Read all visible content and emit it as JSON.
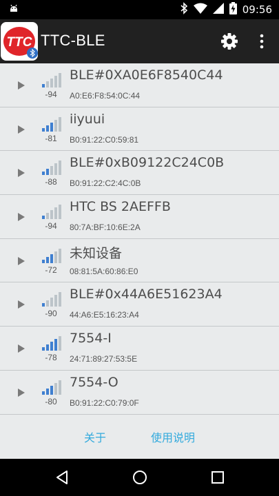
{
  "status_bar": {
    "time": "09:56",
    "icons": [
      "android-debug-icon",
      "bluetooth-icon",
      "wifi-icon",
      "signal-icon",
      "battery-charging-icon"
    ]
  },
  "action_bar": {
    "title": "TTC-BLE",
    "logo_text": "TTC",
    "icons": [
      "gear-icon",
      "overflow-menu-icon"
    ]
  },
  "colors": {
    "accent_link": "#33aadd",
    "signal_active": "#3f7fd0",
    "signal_inactive": "#bcc4c9",
    "logo_red": "#e0252a"
  },
  "devices": [
    {
      "name": "BLE#0XA0E6F8540C44",
      "mac": "A0:E6:F8:54:0C:44",
      "rssi": "-94",
      "bars": 1
    },
    {
      "name": "iiyuui",
      "mac": "B0:91:22:C0:59:81",
      "rssi": "-81",
      "bars": 3
    },
    {
      "name": "BLE#0xB09122C24C0B",
      "mac": "B0:91:22:C2:4C:0B",
      "rssi": "-88",
      "bars": 2
    },
    {
      "name": "HTC BS 2AEFFB",
      "mac": "80:7A:BF:10:6E:2A",
      "rssi": "-94",
      "bars": 1
    },
    {
      "name": "未知设备",
      "mac": "08:81:5A:60:86:E0",
      "rssi": "-72",
      "bars": 3
    },
    {
      "name": "BLE#0x44A6E51623A4",
      "mac": "44:A6:E5:16:23:A4",
      "rssi": "-90",
      "bars": 1
    },
    {
      "name": "7554-I",
      "mac": "24:71:89:27:53:5E",
      "rssi": "-78",
      "bars": 4
    },
    {
      "name": "7554-O",
      "mac": "B0:91:22:C0:79:0F",
      "rssi": "-80",
      "bars": 3
    }
  ],
  "links": {
    "about": "关于",
    "help": "使用说明"
  },
  "nav_bar": {
    "icons": [
      "back-icon",
      "home-icon",
      "recents-icon"
    ]
  }
}
